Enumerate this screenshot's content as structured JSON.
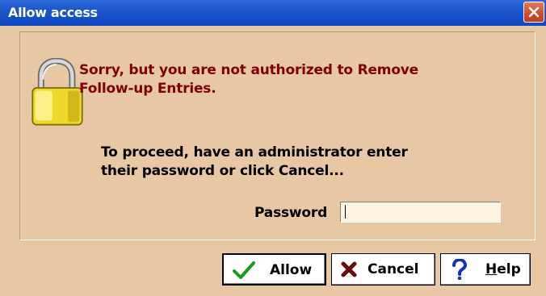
{
  "window": {
    "title": "Allow access",
    "close_icon": "close-icon"
  },
  "message": {
    "error_line1": "Sorry, but you are not authorized to Remove",
    "error_line2": "Follow-up Entries.",
    "proceed_line1": "To proceed, have an administrator enter",
    "proceed_line2": "their password or click Cancel..."
  },
  "password": {
    "label": "Password",
    "value": ""
  },
  "buttons": {
    "allow_label": "Allow",
    "cancel_label": "Cancel",
    "help_label_prefix": "",
    "help_label_underlined": "H",
    "help_label_rest": "elp"
  },
  "icons": {
    "lock": "lock-icon",
    "check": "checkmark-icon",
    "cancel": "x-icon",
    "help": "question-mark-icon"
  },
  "colors": {
    "title_bar": "#1a55cc",
    "dialog_background": "#e8c8a4",
    "error_text": "#800000",
    "close_button": "#d24a28",
    "check": "#1a9a1a",
    "cancel_x": "#6a0c0c",
    "help_q": "#1030c0"
  }
}
